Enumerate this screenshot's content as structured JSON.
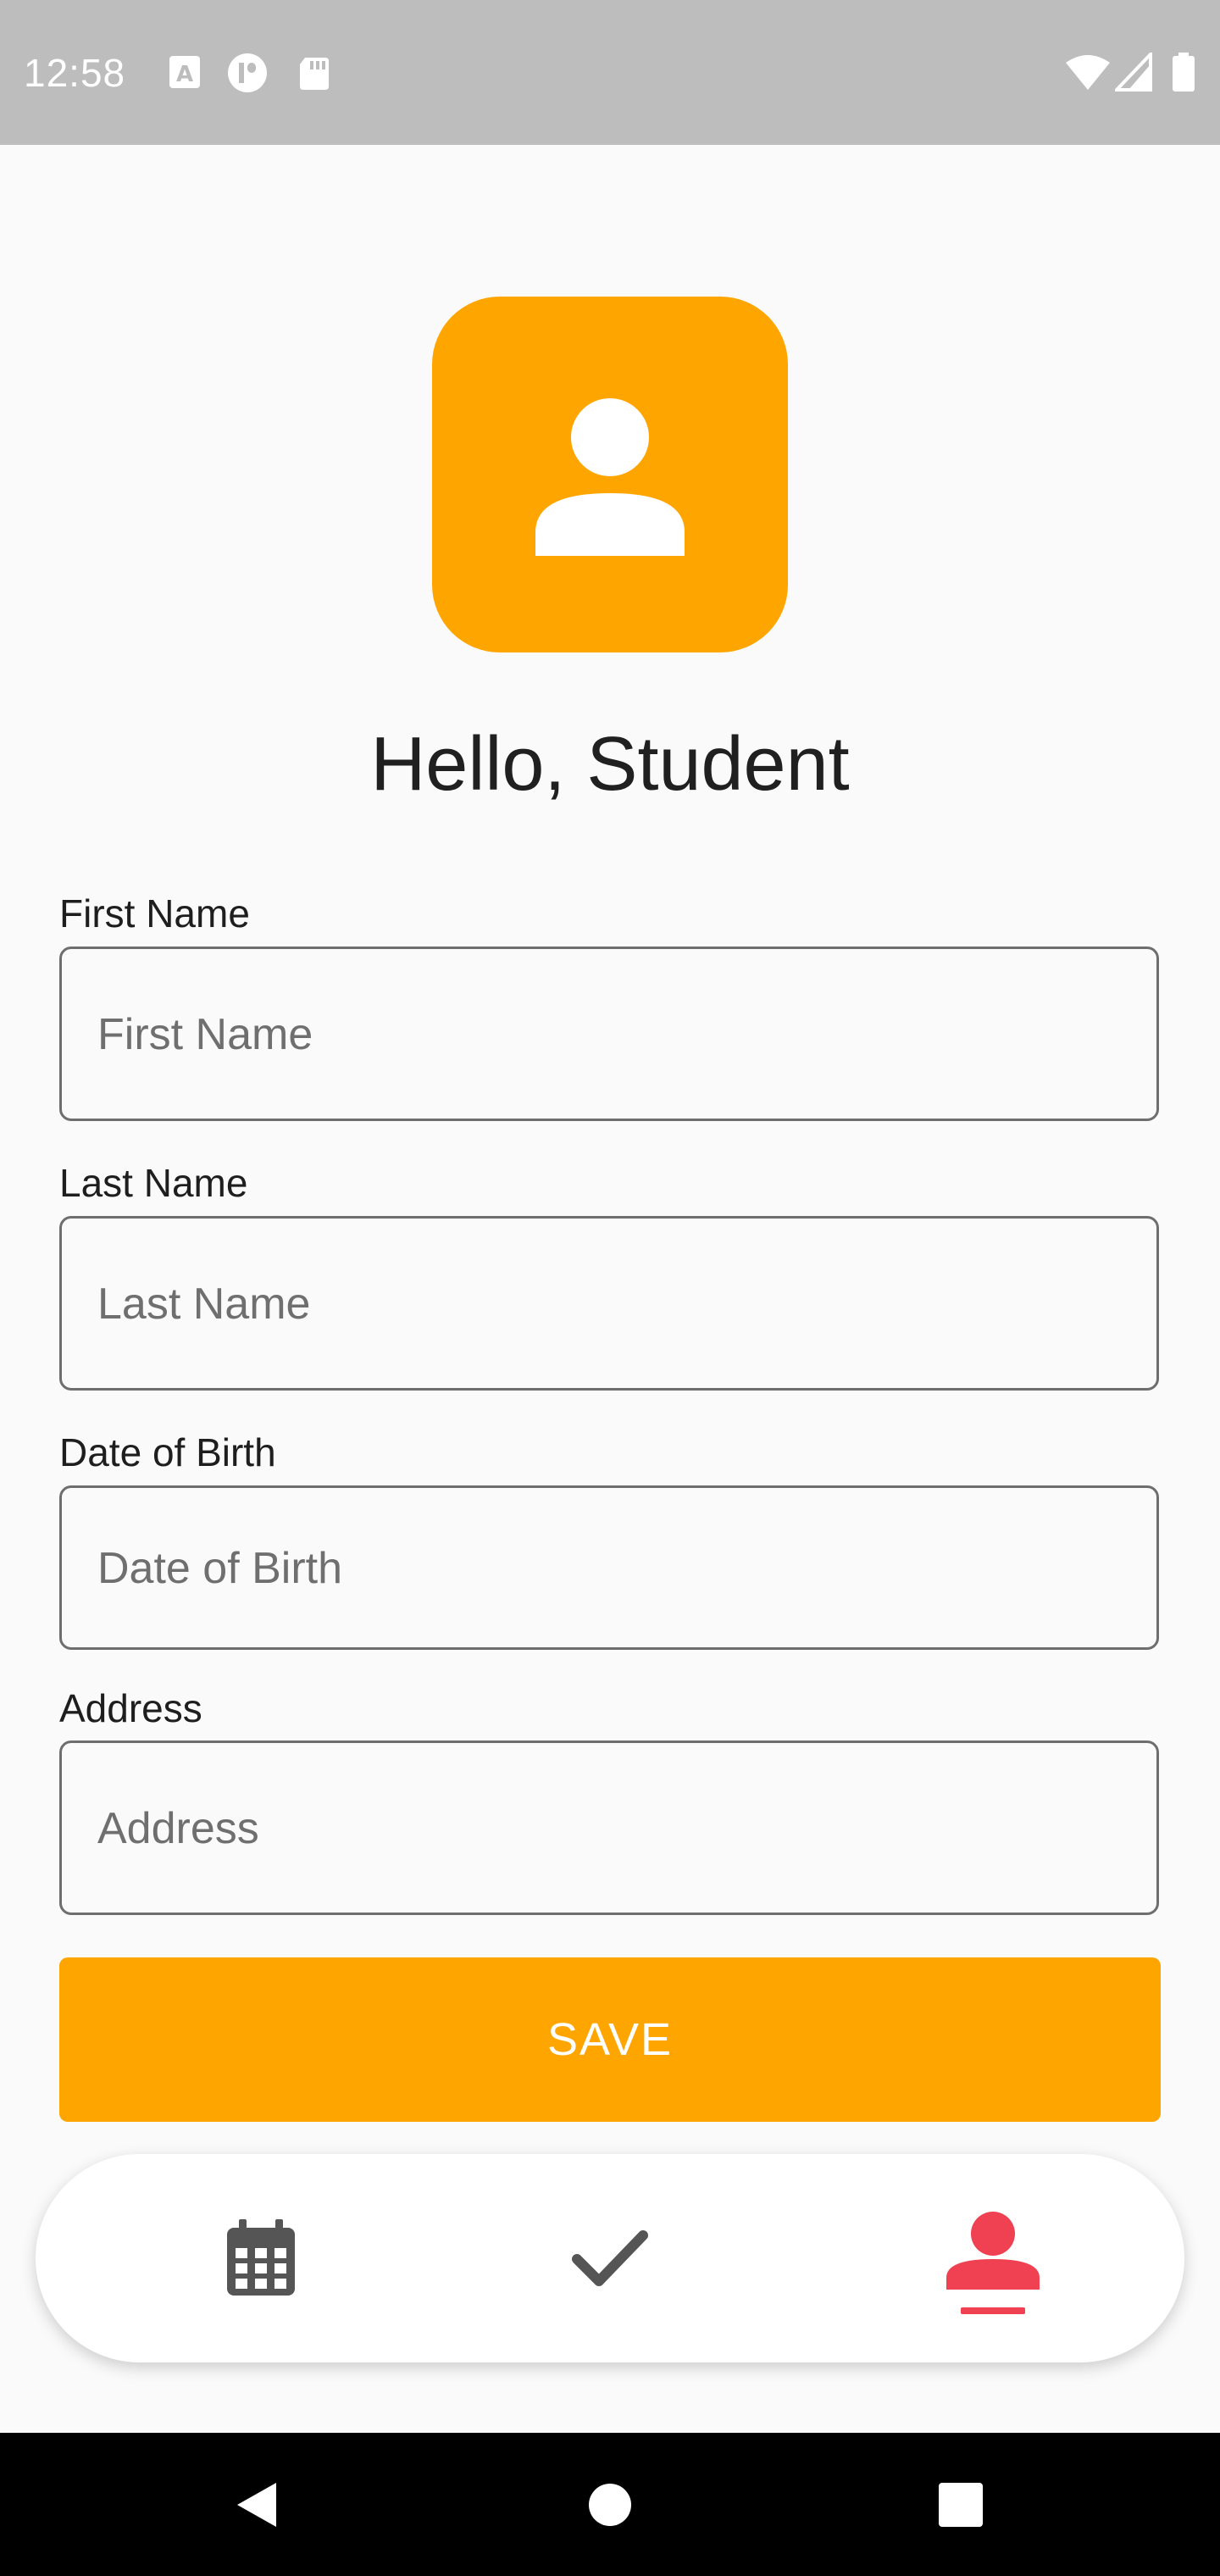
{
  "status_bar": {
    "time": "12:58",
    "left_icons": [
      "a-box-icon",
      "circle-p-icon",
      "sd-card-icon"
    ],
    "right_icons": [
      "wifi-icon",
      "signal-icon",
      "battery-icon"
    ]
  },
  "profile": {
    "avatar_icon": "person-icon",
    "greeting": "Hello, Student"
  },
  "form": {
    "first_name": {
      "label": "First Name",
      "placeholder": "First Name",
      "value": ""
    },
    "last_name": {
      "label": "Last Name",
      "placeholder": "Last Name",
      "value": ""
    },
    "dob": {
      "label": "Date of Birth",
      "placeholder": "Date of Birth",
      "value": ""
    },
    "address": {
      "label": "Address",
      "placeholder": "Address",
      "value": ""
    },
    "save_label": "SAVE"
  },
  "bottom_nav": {
    "items": [
      {
        "icon": "calendar-icon",
        "active": false
      },
      {
        "icon": "check-icon",
        "active": false
      },
      {
        "icon": "person-icon",
        "active": true
      }
    ]
  },
  "colors": {
    "accent": "#ffa500",
    "active_nav": "#ef4152",
    "inactive_nav": "#555555",
    "background": "#fafafa",
    "status_bar": "#bdbdbd"
  }
}
